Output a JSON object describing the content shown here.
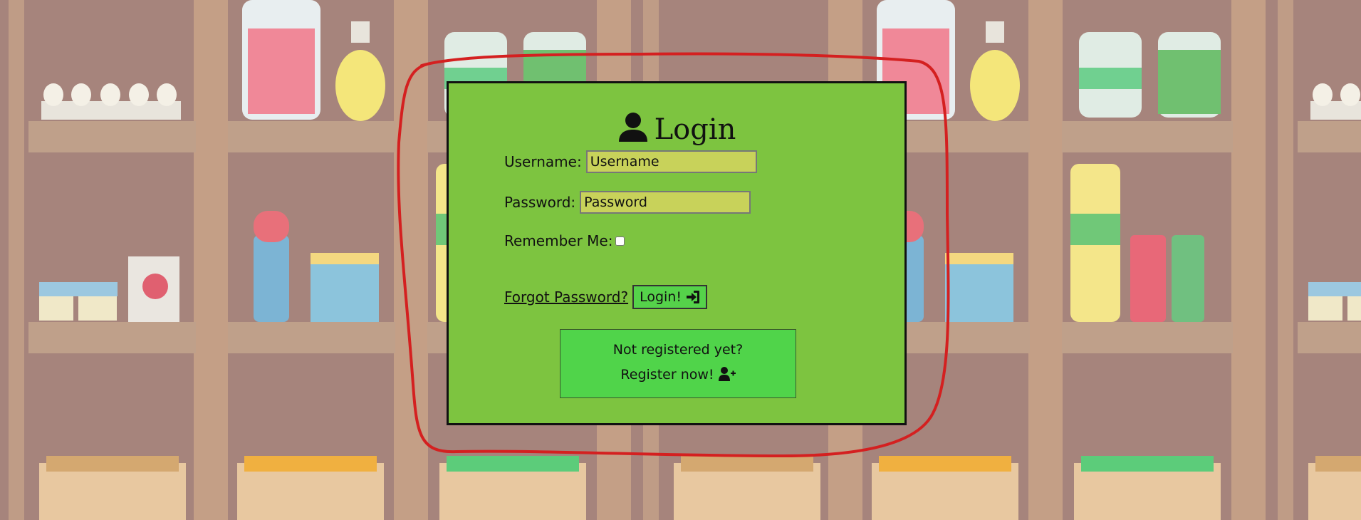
{
  "login": {
    "title": "Login",
    "username_label": "Username:",
    "username_placeholder": "Username",
    "password_label": "Password:",
    "password_placeholder": "Password",
    "remember_label": "Remember Me:",
    "forgot_label": "Forgot Password?",
    "login_button": "Login!",
    "register_line1": "Not registered yet?",
    "register_line2": "Register now!"
  },
  "icons": {
    "title_icon": "user-icon",
    "login_icon": "sign-in-icon",
    "register_icon": "user-plus-icon"
  },
  "colors": {
    "background": "#a6847c",
    "panel": "#7dc440",
    "input": "#c8d25a",
    "register_box": "#50d44a",
    "annotation": "#d42020"
  }
}
